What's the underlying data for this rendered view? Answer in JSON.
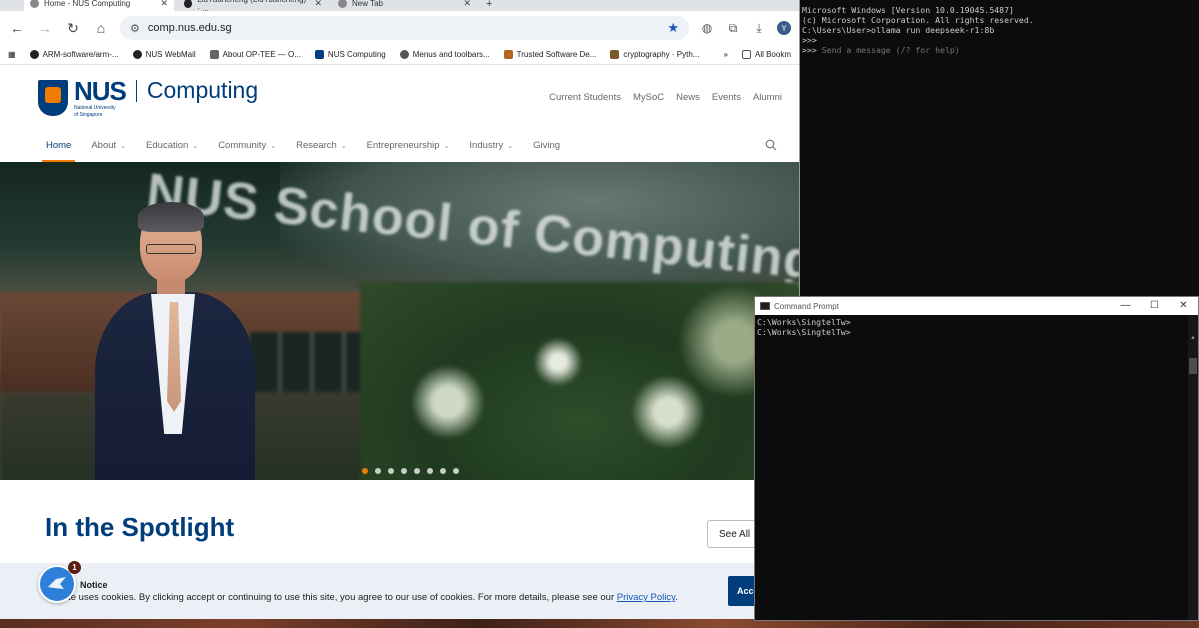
{
  "browser": {
    "tabs": [
      {
        "title": "Home - NUS Computing",
        "active": true
      },
      {
        "title": "LiuYuancheng (LiuYuancheng) · ...",
        "active": false
      },
      {
        "title": "New Tab",
        "active": false
      }
    ],
    "new_tab_label": "+",
    "url": "comp.nus.edu.sg",
    "profile_initial": "Y",
    "bookmarks": [
      "ARM-software/arm-...",
      "NUS WebMail",
      "About OP-TEE — O...",
      "NUS Computing",
      "Menus and toolbars...",
      "Trusted Software De...",
      "cryptography · Pyth..."
    ],
    "bookmarks_overflow": "»",
    "all_bookmarks": "All Bookm"
  },
  "site": {
    "logo_nus": "NUS",
    "logo_sub1": "National University",
    "logo_sub2": "of Singapore",
    "logo_computing": "Computing",
    "util_nav": [
      "Current Students",
      "MySoC",
      "News",
      "Events",
      "Alumni"
    ],
    "main_nav": [
      {
        "label": "Home",
        "caret": false,
        "active": true
      },
      {
        "label": "About",
        "caret": true
      },
      {
        "label": "Education",
        "caret": true
      },
      {
        "label": "Community",
        "caret": true
      },
      {
        "label": "Research",
        "caret": true
      },
      {
        "label": "Entrepreneurship",
        "caret": true
      },
      {
        "label": "Industry",
        "caret": true
      },
      {
        "label": "Giving",
        "caret": false
      }
    ],
    "hero_text": "NUS School of Computing",
    "carousel": {
      "count": 8,
      "active_index": 0
    },
    "spotlight_title": "In the Spotlight",
    "see_all": "See All",
    "notice": {
      "title": "Notice",
      "text": "ite uses cookies. By clicking accept or continuing to use this site, you agree to our use of cookies. For more details, please see our ",
      "link": "Privacy Policy",
      "end": ".",
      "accept": "Acce"
    },
    "chat_badge": "1"
  },
  "terminal_main": {
    "lines": [
      "Microsoft Windows [Version 10.0.19045.5487]",
      "(c) Microsoft Corporation. All rights reserved.",
      "",
      "C:\\Users\\User>ollama run deepseek-r1:8b",
      ">>>",
      ">>> "
    ],
    "placeholder": "Send a message (/? for help)"
  },
  "terminal_cmd": {
    "title": "Command Prompt",
    "lines": [
      "C:\\Works\\SingtelTw>",
      "",
      "C:\\Works\\SingtelTw>"
    ],
    "minimize": "—",
    "maximize": "☐",
    "close": "✕"
  }
}
